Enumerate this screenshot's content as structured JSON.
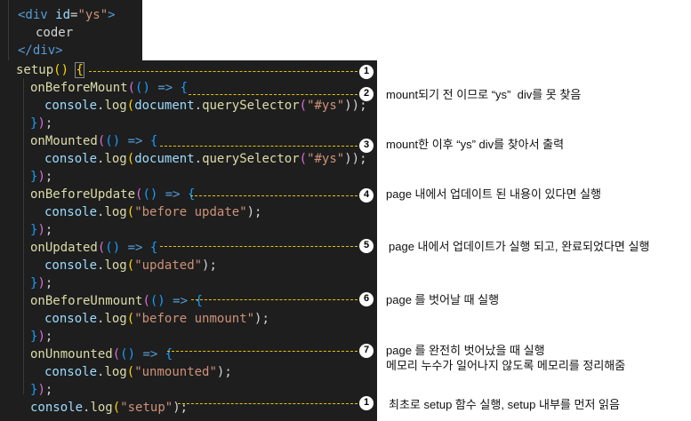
{
  "template": {
    "open_tag_prefix": "<div ",
    "id_attr": "id",
    "eq": "=",
    "id_value": "\"ys\"",
    "open_tag_suffix": ">",
    "text": "coder",
    "close_tag": "</div>"
  },
  "setup": {
    "name": "setup",
    "parens": "()",
    "open_brace": "{",
    "close_all": "});"
  },
  "hooks": [
    {
      "name": "onBeforeMount",
      "body_fn": "console",
      "body_method": "log",
      "body_arg": "document",
      "body_arg_method": "querySelector",
      "body_arg_str": "\"#ys\"",
      "tail": "));"
    },
    {
      "name": "onMounted",
      "body_fn": "console",
      "body_method": "log",
      "body_arg": "document",
      "body_arg_method": "querySelector",
      "body_arg_str": "\"#ys\"",
      "tail": "));"
    },
    {
      "name": "onBeforeUpdate",
      "body_fn": "console",
      "body_method": "log",
      "body_arg_str": "\"before update\"",
      "tail": ");"
    },
    {
      "name": "onUpdated",
      "body_fn": "console",
      "body_method": "log",
      "body_arg_str": "\"updated\"",
      "tail": ");"
    },
    {
      "name": "onBeforeUnmount",
      "body_fn": "console",
      "body_method": "log",
      "body_arg_str": "\"before unmount\"",
      "tail": ");"
    },
    {
      "name": "onUnmounted",
      "body_fn": "console",
      "body_method": "log",
      "body_arg_str": "\"unmounted\"",
      "tail": ");"
    }
  ],
  "last_line": {
    "fn": "console",
    "method": "log",
    "arg": "\"setup\"",
    "tail": ");"
  },
  "markers": [
    "1",
    "2",
    "3",
    "4",
    "5",
    "6",
    "7",
    "1"
  ],
  "notes": {
    "n2": "mount되기 전 이므로 “ys”  div를 못 찾음",
    "n3": "mount한 이후 “ys” div를 찾아서 출력",
    "n4": "page 내에서 업데이트 된 내용이 있다면 실행",
    "n5": "page 내에서 업데이트가 실행 되고, 완료되었다면 실행",
    "n6": "page 를 벗어날 때 실행",
    "n7a": "page 를 완전히 벗어났을 때 실행",
    "n7b": "메모리 누수가 일어나지 않도록 메모리를 정리해줌",
    "n8": "최초로 setup 함수 실행, setup 내부를 먼저 읽음"
  },
  "colors": {
    "background": "#1e1e1e",
    "tag": "#569cd6",
    "string": "#ce9178",
    "function": "#dcdcaa",
    "variable": "#9cdcfe",
    "dash": "#e9c400"
  }
}
